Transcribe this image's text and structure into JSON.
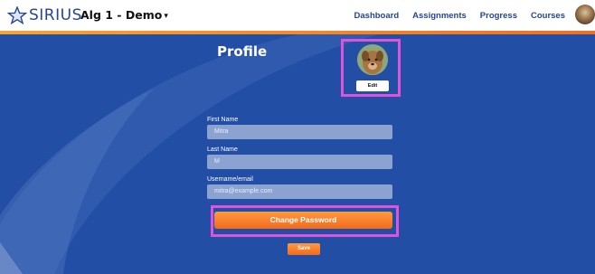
{
  "brand": {
    "name": "SIRIUS",
    "icon": "star-icon",
    "color": "#24459a"
  },
  "course_selector": {
    "label": "Alg 1 - Demo",
    "icon": "chevron-down-icon"
  },
  "nav": {
    "items": [
      {
        "label": "Dashboard"
      },
      {
        "label": "Assignments"
      },
      {
        "label": "Progress"
      },
      {
        "label": "Courses"
      }
    ]
  },
  "colors": {
    "panel": "#234ea5",
    "accent": "#f26a1d",
    "highlight": "#e052d8"
  },
  "profile": {
    "title": "Profile",
    "edit_label": "Edit",
    "fields": {
      "first_name": {
        "label": "First Name",
        "value": "Mitra"
      },
      "last_name": {
        "label": "Last Name",
        "value": "M"
      },
      "username": {
        "label": "Username/email",
        "value": "mitra@example.com"
      }
    },
    "change_password_label": "Change Password",
    "save_label": "Save"
  }
}
